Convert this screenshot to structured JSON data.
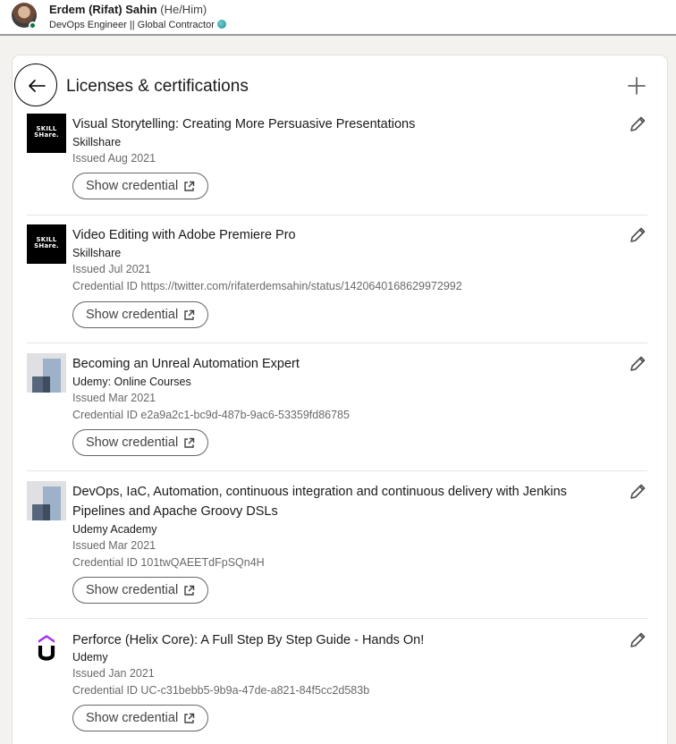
{
  "profile": {
    "name": "Erdem (Rifat) Sahin",
    "pronouns": "(He/Him)",
    "headline": "DevOps Engineer || Global Contractor"
  },
  "section": {
    "title": "Licenses & certifications"
  },
  "entries": [
    {
      "title": "Visual Storytelling: Creating More Persuasive Presentations",
      "org": "Skillshare",
      "issued": "Issued Aug 2021",
      "credential": "",
      "button": "Show credential",
      "logo_text_1": "SKILL",
      "logo_text_2": "SHare."
    },
    {
      "title": " Video Editing with Adobe Premiere Pro",
      "org": "Skillshare",
      "issued": "Issued Jul 2021",
      "credential": "Credential ID https://twitter.com/rifaterdemsahin/status/1420640168629972992",
      "button": "Show credential",
      "logo_text_1": "SKILL",
      "logo_text_2": "SHare."
    },
    {
      "title": "Becoming an Unreal Automation Expert",
      "org": "Udemy: Online Courses",
      "issued": "Issued Mar 2021",
      "credential": "Credential ID e2a9a2c1-bc9d-487b-9ac6-53359fd86785",
      "button": "Show credential"
    },
    {
      "title": "DevOps, IaC, Automation, continuous integration and continuous delivery with Jenkins Pipelines and Apache Groovy DSLs",
      "org": "Udemy Academy",
      "issued": "Issued Mar 2021",
      "credential": "Credential ID 101twQAEETdFpSQn4H",
      "button": "Show credential"
    },
    {
      "title": "Perforce (Helix Core): A Full Step By Step Guide - Hands On!",
      "org": "Udemy",
      "issued": "Issued Jan 2021",
      "credential": "Credential ID UC-c31bebb5-9b9a-47de-a821-84f5cc2d583b",
      "button": "Show credential"
    }
  ],
  "icons": {
    "back": "arrow-left-icon",
    "add": "plus-icon",
    "edit": "pencil-icon",
    "external": "external-link-icon"
  },
  "colors": {
    "presence": "#057642",
    "udemy_purple": "#a435f0"
  }
}
